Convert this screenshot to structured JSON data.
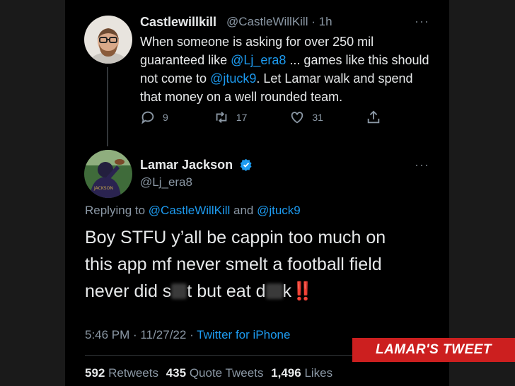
{
  "reply_tweet": {
    "author_name": "Castlewillkill",
    "author_handle": "@CastleWillKill",
    "time_sep": " · ",
    "time": "1h",
    "text_parts": [
      "When someone is asking for over 250 mil guaranteed like ",
      "@Lj_era8",
      " ... games like this should not come to ",
      "@jtuck9",
      ". Let Lamar walk and spend that money on a well rounded team."
    ],
    "replies": "9",
    "retweets": "17",
    "likes": "31",
    "more": "···"
  },
  "main_tweet": {
    "author_name": "Lamar Jackson",
    "author_handle": "@Lj_era8",
    "more": "···",
    "replying_prefix": "Replying to ",
    "replying_to_1": "@CastleWillKill",
    "replying_and": " and ",
    "replying_to_2": "@jtuck9",
    "text_line1": "Boy STFU y’all be cappin too much on",
    "text_line2": "this app mf never smelt a football field",
    "text_line3a": "never did s",
    "text_line3b": "t but eat d",
    "text_line3c": "k",
    "emoji": "‼️",
    "time": "5:46 PM",
    "date_sep": " · ",
    "date": "11/27/22",
    "source_sep": " · ",
    "source": "Twitter for iPhone",
    "retweets_count": "592",
    "retweets_label": "Retweets",
    "quotes_count": "435",
    "quotes_label": "Quote Tweets",
    "likes_count": "1,496",
    "likes_label": "Likes"
  },
  "banner": {
    "label": "LAMAR'S TWEET"
  },
  "colors": {
    "accent": "#1d9bf0",
    "banner": "#cc1f1f",
    "muted": "#8b98a5"
  }
}
